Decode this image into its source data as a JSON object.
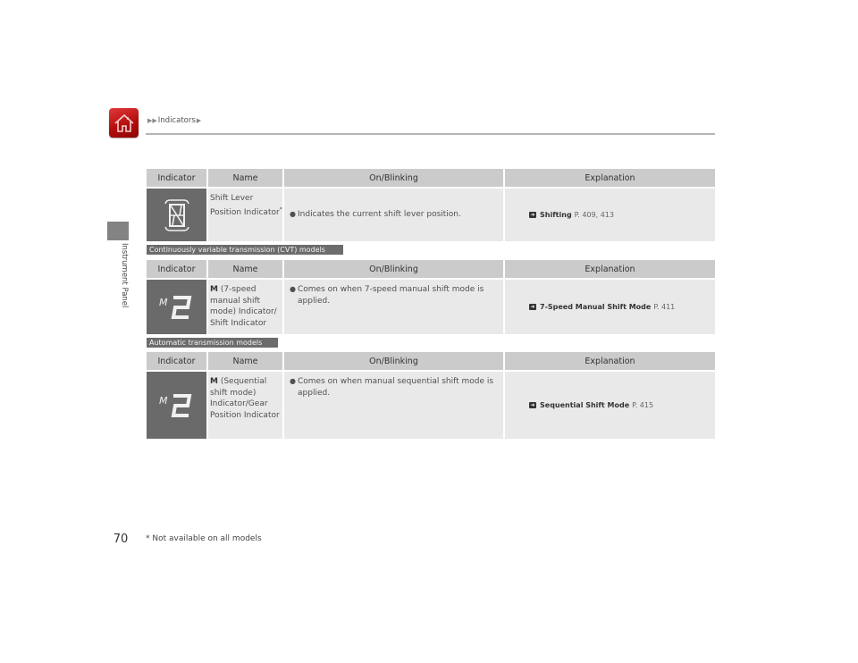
{
  "breadcrumb": {
    "prefix_arrows": "▶▶",
    "current": "Indicators",
    "suffix_arrow": "▶"
  },
  "sidebar": {
    "section_label": "Instrument Panel"
  },
  "page_number": "70",
  "footnote": "* Not available on all models",
  "table_headers": [
    "Indicator",
    "Name",
    "On/Blinking",
    "Explanation"
  ],
  "tables": [
    {
      "tag": null,
      "row": {
        "icon": "shift-lever-position-icon",
        "name_bold": "",
        "name_rest": "Shift Lever Position Indicator",
        "name_sup": "*",
        "on_blinking": [
          "Indicates the current shift lever position."
        ],
        "explanation": {
          "title": "Shifting",
          "page": "P. 409, 413"
        }
      }
    },
    {
      "tag": "Continuously variable transmission (CVT) models",
      "row": {
        "icon": "m2-shift-indicator-icon",
        "name_bold": "M",
        "name_rest": " (7-speed manual shift mode) Indicator/ Shift Indicator",
        "name_sup": "",
        "on_blinking": [
          "Comes on when 7-speed manual shift mode is applied."
        ],
        "explanation": {
          "title": "7-Speed Manual Shift Mode",
          "page": "P. 411"
        }
      }
    },
    {
      "tag": "Automatic transmission models",
      "row": {
        "icon": "m2-gear-position-icon",
        "name_bold": "M",
        "name_rest": " (Sequential shift mode) Indicator/Gear Position Indicator",
        "name_sup": "",
        "on_blinking": [
          "Comes on when manual sequential shift mode is applied."
        ],
        "explanation": {
          "title": "Sequential Shift Mode",
          "page": "P. 415"
        }
      }
    }
  ],
  "colors": {
    "home_button": "#c41414",
    "header_cell": "#cbcbcb",
    "body_cell": "#e9e9e9",
    "icon_cell": "#6a6a6a",
    "tag": "#6c6c6c"
  }
}
